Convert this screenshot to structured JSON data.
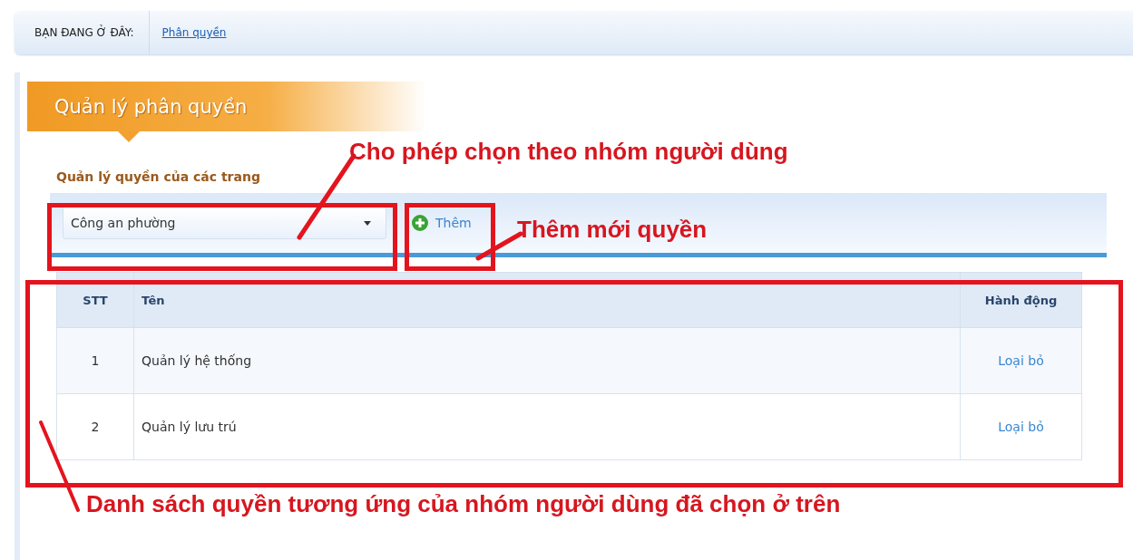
{
  "breadcrumb": {
    "label": "BẠN ĐANG Ở ĐÂY:",
    "link": "Phân quyền"
  },
  "panel_title": "Quản lý phân quyền",
  "section_title": "Quản lý quyền của các trang",
  "group_select": {
    "value": "Công an phường"
  },
  "add_button": {
    "label": "Thêm"
  },
  "table": {
    "columns": [
      "STT",
      "Tên",
      "Hành động"
    ],
    "rows": [
      {
        "stt": "1",
        "name": "Quản lý hệ thống",
        "action": "Loại bỏ"
      },
      {
        "stt": "2",
        "name": "Quản lý lưu trú",
        "action": "Loại bỏ"
      }
    ]
  },
  "annotations": [
    "Cho phép chọn theo nhóm người dùng",
    "Thêm mới quyền",
    "Danh sách quyền tương ứng của nhóm người dùng đã chọn ở trên"
  ]
}
